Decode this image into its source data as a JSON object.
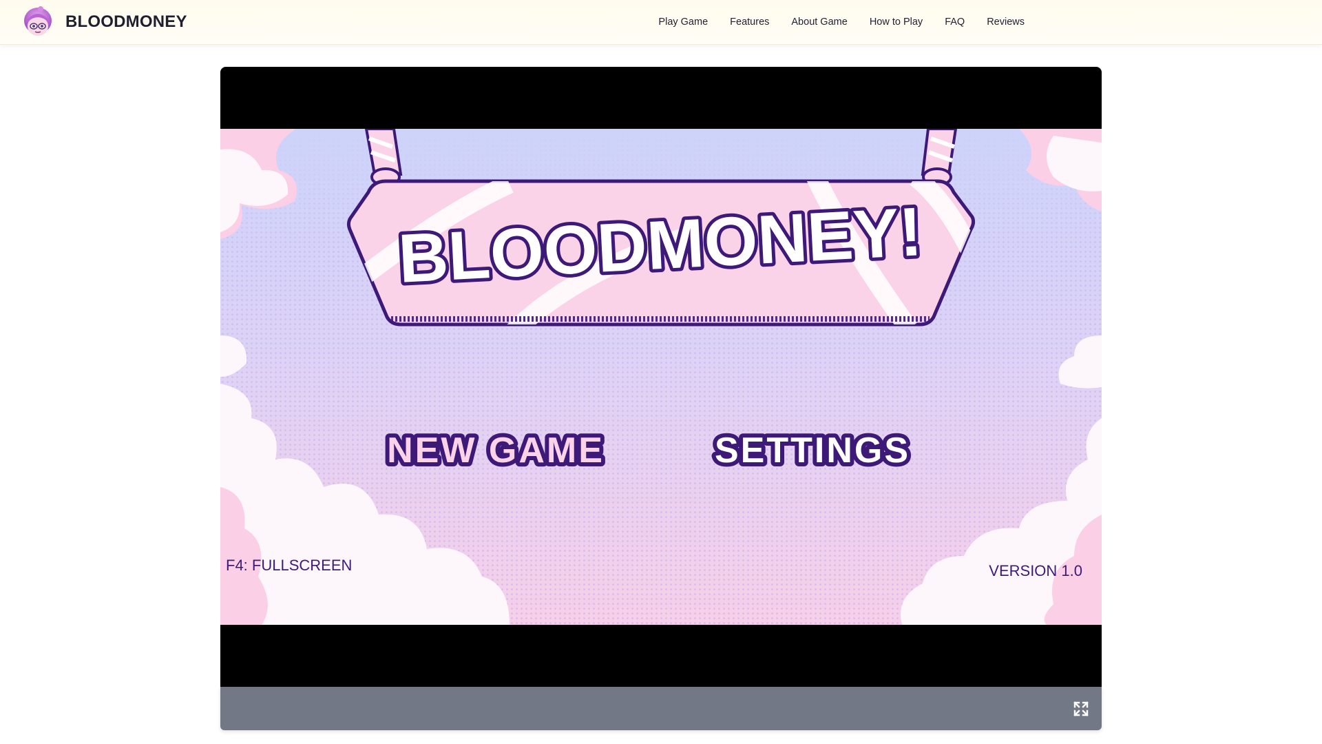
{
  "header": {
    "brand_name": "BLOODMONEY",
    "brand_icon": "character-avatar-icon",
    "nav": [
      {
        "label": "Play Game"
      },
      {
        "label": "Features"
      },
      {
        "label": "About Game"
      },
      {
        "label": "How to Play"
      },
      {
        "label": "FAQ"
      },
      {
        "label": "Reviews"
      }
    ]
  },
  "game": {
    "title": "BLOODMONEY!",
    "menu": {
      "new_game": "NEW GAME",
      "settings": "SETTINGS"
    },
    "hint": "F4: FULLSCREEN",
    "version": "VERSION 1.0"
  },
  "controls": {
    "fullscreen_icon": "fullscreen-expand-icon"
  },
  "colors": {
    "header_bg": "#fffbee",
    "brand_text": "#1f1f2e",
    "game_outline": "#3d1a78",
    "sky_top": "#cdd3fa",
    "sky_bottom": "#f7cfe8",
    "sign_pink": "#fbd3e9",
    "cloud_white": "#fdf7fb",
    "cloud_pink": "#fbcfe6",
    "controls_bar": "#737887"
  }
}
